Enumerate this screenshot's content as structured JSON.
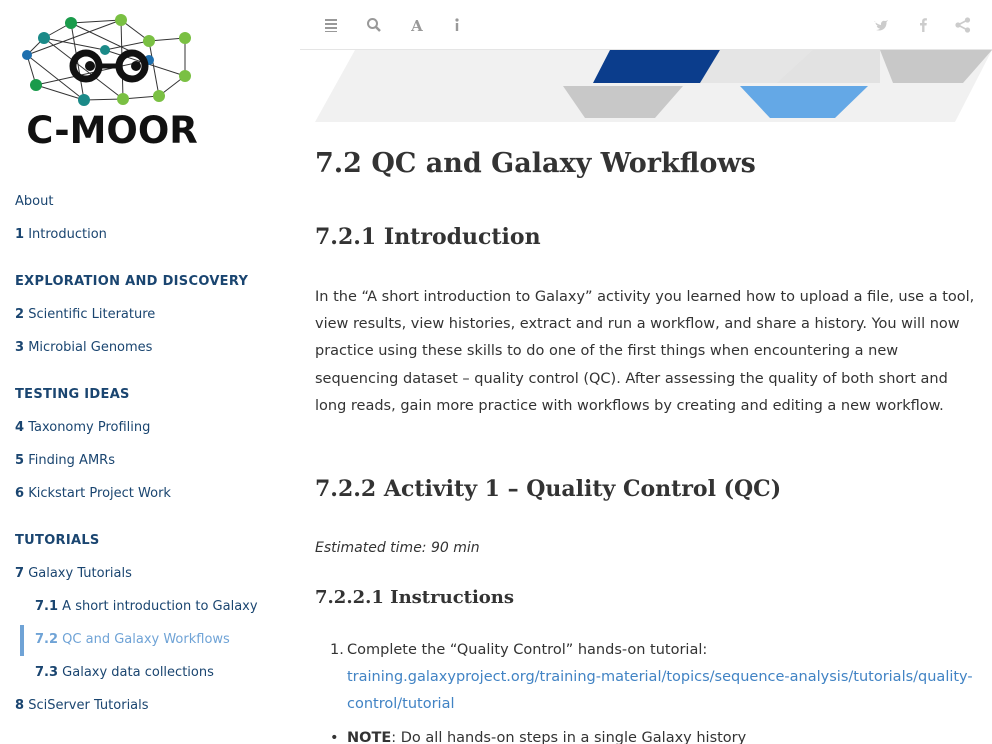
{
  "logo": {
    "text": "C-MOOR",
    "colors": {
      "green": "#1a9b4b",
      "lime": "#7ac043",
      "teal": "#1b8a88",
      "blue": "#1e6fae"
    }
  },
  "toolbar": {
    "left_icons": [
      "list-icon",
      "search-icon",
      "font-icon",
      "info-icon"
    ],
    "right_icons": [
      "twitter-icon",
      "facebook-icon",
      "share-icon"
    ]
  },
  "toc": {
    "about": "About",
    "ch1": {
      "num": "1",
      "label": "Introduction"
    },
    "sec_exploration": "EXPLORATION AND DISCOVERY",
    "ch2": {
      "num": "2",
      "label": "Scientific Literature"
    },
    "ch3": {
      "num": "3",
      "label": "Microbial Genomes"
    },
    "sec_testing": "TESTING IDEAS",
    "ch4": {
      "num": "4",
      "label": "Taxonomy Profiling"
    },
    "ch5": {
      "num": "5",
      "label": "Finding AMRs"
    },
    "ch6": {
      "num": "6",
      "label": "Kickstart Project Work"
    },
    "sec_tutorials": "TUTORIALS",
    "ch7": {
      "num": "7",
      "label": "Galaxy Tutorials"
    },
    "ch7_1": {
      "num": "7.1",
      "label": "A short introduction to Galaxy"
    },
    "ch7_2": {
      "num": "7.2",
      "label": "QC and Galaxy Workflows"
    },
    "ch7_3": {
      "num": "7.3",
      "label": "Galaxy data collections"
    },
    "ch8": {
      "num": "8",
      "label": "SciServer Tutorials"
    }
  },
  "content": {
    "h1": "7.2   QC and Galaxy Workflows",
    "h2_intro": "7.2.1   Introduction",
    "intro_paragraph": "In the “A short introduction to Galaxy” activity you learned how to upload a file, use a tool, view results, view histories, extract and run a workflow, and share a history. You will now practice using these skills to do one of the first things when encountering a new sequencing dataset – quality control (QC). After assessing the quality of both short and long reads, gain more practice with workflows by creating and editing a new workflow.",
    "h2_activity": "7.2.2   Activity 1 – Quality Control (QC)",
    "estimated_time": "Estimated time: 90 min",
    "h3_instructions": "7.2.2.1   Instructions",
    "step1_text": "Complete the “Quality Control” hands-on tutorial:",
    "step1_link": "training.galaxyproject.org/training-material/topics/sequence-analysis/tutorials/quality-control/tutorial",
    "step1_marker": "1.",
    "note_label": "NOTE",
    "note_text": ": Do all hands-on steps in a single Galaxy history"
  },
  "colors": {
    "nav_text": "#1a4570",
    "active": "#6fa3d6",
    "link": "#4183c4",
    "banner_dark": "#0b3d8c",
    "banner_light": "#64a8e6"
  }
}
